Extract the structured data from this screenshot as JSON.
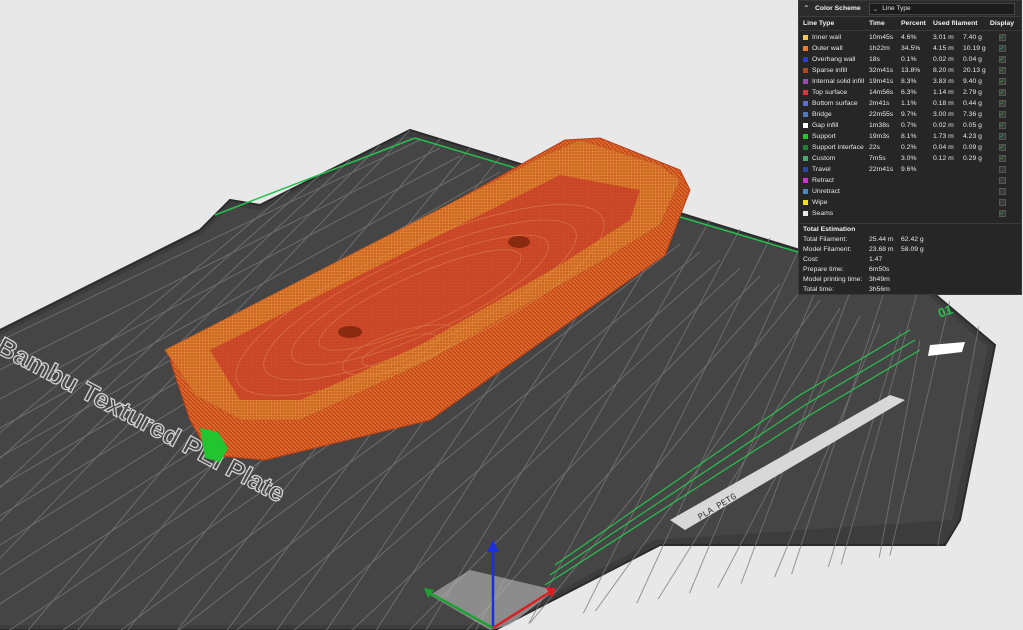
{
  "plate": {
    "label": "Bambu Textured PEI Plate",
    "number": "01",
    "side_text": "PLA PETG"
  },
  "legend": {
    "title": "Color Scheme",
    "scheme_value": "Line Type",
    "headers": {
      "type": "Line Type",
      "time": "Time",
      "percent": "Percent",
      "filament": "Used filament",
      "display": "Display"
    },
    "rows": [
      {
        "name": "Inner wall",
        "color": "#f0c850",
        "time": "10m45s",
        "percent": "4.6%",
        "length": "3.01 m",
        "weight": "7.40 g",
        "display": true
      },
      {
        "name": "Outer wall",
        "color": "#f07c30",
        "time": "1h22m",
        "percent": "34.5%",
        "length": "4.15 m",
        "weight": "10.19 g",
        "display": true
      },
      {
        "name": "Overhang wall",
        "color": "#2a3cc8",
        "time": "18s",
        "percent": "0.1%",
        "length": "0.02 m",
        "weight": "0.04 g",
        "display": true
      },
      {
        "name": "Sparse infill",
        "color": "#a84a2a",
        "time": "32m41s",
        "percent": "13.8%",
        "length": "8.20 m",
        "weight": "20.13 g",
        "display": true
      },
      {
        "name": "Internal solid infill",
        "color": "#9a4ab0",
        "time": "19m41s",
        "percent": "8.3%",
        "length": "3.83 m",
        "weight": "9.40 g",
        "display": true
      },
      {
        "name": "Top surface",
        "color": "#d8383a",
        "time": "14m56s",
        "percent": "6.3%",
        "length": "1.14 m",
        "weight": "2.79 g",
        "display": true
      },
      {
        "name": "Bottom surface",
        "color": "#5a70c8",
        "time": "2m41s",
        "percent": "1.1%",
        "length": "0.18 m",
        "weight": "0.44 g",
        "display": true
      },
      {
        "name": "Bridge",
        "color": "#4d7ab8",
        "time": "22m55s",
        "percent": "9.7%",
        "length": "3.00 m",
        "weight": "7.36 g",
        "display": true
      },
      {
        "name": "Gap infill",
        "color": "#ffffff",
        "time": "1m38s",
        "percent": "0.7%",
        "length": "0.02 m",
        "weight": "0.05 g",
        "display": true
      },
      {
        "name": "Support",
        "color": "#22c430",
        "time": "19m3s",
        "percent": "8.1%",
        "length": "1.73 m",
        "weight": "4.23 g",
        "display": true
      },
      {
        "name": "Support interface",
        "color": "#1e8030",
        "time": "22s",
        "percent": "0.2%",
        "length": "0.04 m",
        "weight": "0.09 g",
        "display": true
      },
      {
        "name": "Custom",
        "color": "#4aa870",
        "time": "7m5s",
        "percent": "3.0%",
        "length": "0.12 m",
        "weight": "0.29 g",
        "display": true
      },
      {
        "name": "Travel",
        "color": "#2a44a8",
        "time": "22m41s",
        "percent": "9.6%",
        "length": "",
        "weight": "",
        "display": false
      },
      {
        "name": "Retract",
        "color": "#d030d0",
        "time": "",
        "percent": "",
        "length": "",
        "weight": "",
        "display": false
      },
      {
        "name": "Unretract",
        "color": "#4a88c0",
        "time": "",
        "percent": "",
        "length": "",
        "weight": "",
        "display": false
      },
      {
        "name": "Wipe",
        "color": "#f0e020",
        "time": "",
        "percent": "",
        "length": "",
        "weight": "",
        "display": false
      },
      {
        "name": "Seams",
        "color": "#e8e8e8",
        "time": "",
        "percent": "",
        "length": "",
        "weight": "",
        "display": true
      }
    ],
    "estimation": {
      "title": "Total Estimation",
      "items": [
        {
          "label": "Total Filament:",
          "v1": "25.44 m",
          "v2": "62.42 g"
        },
        {
          "label": "Model Filament:",
          "v1": "23.68 m",
          "v2": "58.09 g"
        },
        {
          "label": "Cost:",
          "v1": "1.47",
          "v2": ""
        },
        {
          "label": "Prepare time:",
          "v1": "6m50s",
          "v2": ""
        },
        {
          "label": "Model printing time:",
          "v1": "3h49m",
          "v2": ""
        },
        {
          "label": "Total time:",
          "v1": "3h56m",
          "v2": ""
        }
      ]
    }
  }
}
